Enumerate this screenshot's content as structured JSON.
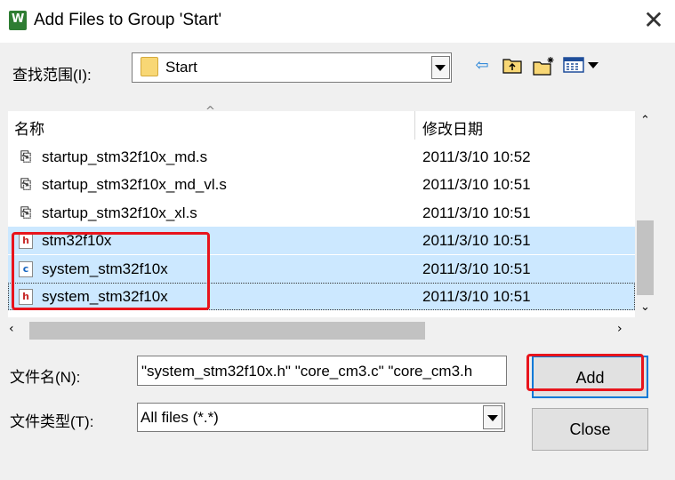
{
  "window": {
    "title": "Add Files to Group 'Start'",
    "close_glyph": "✕",
    "app_icon": "keil-uvision-icon"
  },
  "look_in": {
    "label": "查找范围(I):",
    "value": "Start"
  },
  "toolbar": {
    "back_glyph": "⇦",
    "up_glyph": "⬆",
    "new_folder_glyph": "✱",
    "view_glyph": "▦▾"
  },
  "file_list": {
    "columns": {
      "name": "名称",
      "date": "修改日期"
    },
    "rows": [
      {
        "name": "startup_stm32f10x_md.s",
        "date": "2011/3/10 10:52",
        "icon": "s",
        "selected": false
      },
      {
        "name": "startup_stm32f10x_md_vl.s",
        "date": "2011/3/10 10:51",
        "icon": "s",
        "selected": false
      },
      {
        "name": "startup_stm32f10x_xl.s",
        "date": "2011/3/10 10:51",
        "icon": "s",
        "selected": false
      },
      {
        "name": "stm32f10x",
        "date": "2011/3/10 10:51",
        "icon": "h",
        "selected": true
      },
      {
        "name": "system_stm32f10x",
        "date": "2011/3/10 10:51",
        "icon": "c",
        "selected": true
      },
      {
        "name": "system_stm32f10x",
        "date": "2011/3/10 10:51",
        "icon": "h",
        "selected": true
      }
    ]
  },
  "file_name": {
    "label": "文件名(N):",
    "value": "\"system_stm32f10x.h\" \"core_cm3.c\" \"core_cm3.h"
  },
  "file_type": {
    "label": "文件类型(T):",
    "value": "All files (*.*)"
  },
  "buttons": {
    "add": "Add",
    "close": "Close"
  },
  "colors": {
    "selection": "#cce8ff",
    "highlight": "#e8141c",
    "focus_border": "#0078d7"
  }
}
